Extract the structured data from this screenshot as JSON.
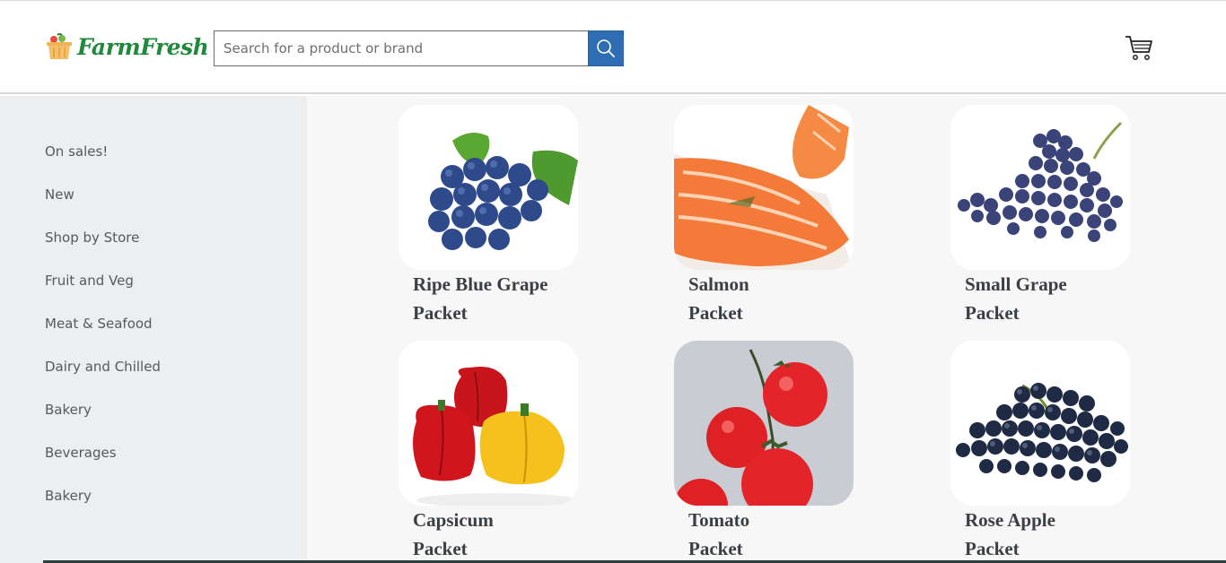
{
  "brand": {
    "name": "FarmFresh",
    "color": "#1f8a3c"
  },
  "search": {
    "placeholder": "Search for a product or brand",
    "button_color": "#2f6db3"
  },
  "sidebar": {
    "items": [
      {
        "label": "On sales!"
      },
      {
        "label": "New"
      },
      {
        "label": "Shop by Store"
      },
      {
        "label": "Fruit and Veg"
      },
      {
        "label": "Meat & Seafood"
      },
      {
        "label": "Dairy and Chilled"
      },
      {
        "label": "Bakery"
      },
      {
        "label": "Beverages"
      },
      {
        "label": "Bakery"
      }
    ]
  },
  "products": [
    {
      "name": "Ripe Blue Grape",
      "unit": "Packet",
      "image": "blue-grapes"
    },
    {
      "name": "Salmon",
      "unit": "Packet",
      "image": "salmon-fillet"
    },
    {
      "name": "Small Grape",
      "unit": "Packet",
      "image": "grape-bunch"
    },
    {
      "name": "Capsicum",
      "unit": "Packet",
      "image": "bell-peppers"
    },
    {
      "name": "Tomato",
      "unit": "Packet",
      "image": "tomatoes"
    },
    {
      "name": "Rose Apple",
      "unit": "Packet",
      "image": "dark-grapes"
    }
  ]
}
